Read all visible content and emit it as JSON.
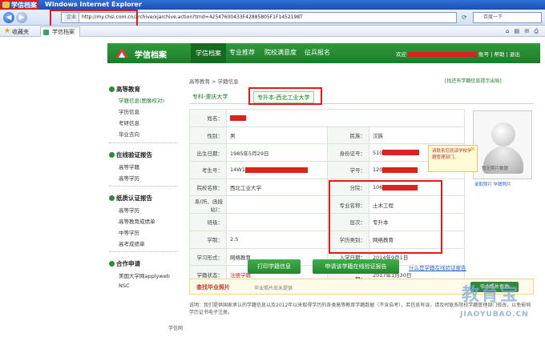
{
  "window": {
    "tab_title": "学信档案",
    "app_title": "Windows Internet Explorer"
  },
  "address": {
    "label": "企业",
    "url": "http://my.chsi.com.cn/archive/xjarchive.action?trnd=42547600433F42885805F1F1452198T"
  },
  "search": {
    "placeholder": "百度一下"
  },
  "favorites": {
    "label": "收藏夹",
    "tab": "学信档案"
  },
  "site": {
    "logo_text": "学信档案",
    "nav": [
      "学信档案",
      "专业推荐",
      "院校满意度",
      "征兵报名"
    ],
    "welcome_prefix": "欢迎",
    "account": "账号",
    "help": "帮助",
    "logout": "退出"
  },
  "sidebar": {
    "groups": [
      {
        "title": "高等教育",
        "items": [
          "学籍信息(图像校对)",
          "学历信息",
          "考研信息",
          "毕业去向"
        ]
      },
      {
        "title": "在线验证报告",
        "items": [
          "高等学籍",
          "高等学历"
        ]
      },
      {
        "title": "纸质认证报告",
        "items": [
          "高等学历",
          "高等教育成绩单",
          "中等学历",
          "高考成绩单"
        ]
      },
      {
        "title": "合作申请",
        "items": [
          "美国大学网applyweb",
          "NSC"
        ]
      }
    ]
  },
  "breadcrumb": "高等教育 > 学籍信息",
  "top_link": "[找还有学籍信息提示出局]",
  "tabs": {
    "first": "专科-重庆大学",
    "second": "专升本-西北工业大学"
  },
  "info": {
    "name_label": "姓名：",
    "gender_label": "性别：",
    "gender": "男",
    "ethnicity_label": "民族：",
    "ethnicity": "汉族",
    "birth_label": "出生日期：",
    "birth": "1985年5月29日",
    "id_label": "身份证号：",
    "id_prefix": "510",
    "exam_label": "考生号：",
    "exam_prefix": "14W1",
    "student_no_label": "学号：",
    "student_no_prefix": "120",
    "school_label": "院校名称：",
    "school": "西北工业大学",
    "branch_label": "分院：",
    "branch_prefix": "106",
    "dept_label": "系(所、函授站)：",
    "major_label": "专业名称：",
    "major": "土木工程",
    "class_label": "班级：",
    "level_label": "层次：",
    "level": "专升本",
    "duration_label": "学制：",
    "duration": "2.5",
    "type_label": "学历类别：",
    "type": "网络教育",
    "form_label": "学习形式：",
    "form": "网络教育",
    "enroll_label": "入学日期：",
    "enroll": "2014年9月1日",
    "status_label": "学籍状态：",
    "status": "注册学籍",
    "grad_label": "预计毕业日期：",
    "grad": "2017年1月30日"
  },
  "photo": {
    "tooltip": "请联系您就读学校学籍管理部门。",
    "caption": "暂无照片数据",
    "links": "录取照片   学籍照片"
  },
  "buttons": {
    "print": "打印学籍信息",
    "apply": "申请该学籍在线验证报告",
    "help_link": "什么是学籍在线验证报告"
  },
  "grad_photo": {
    "title": "查找毕业照片",
    "subtitle": "毕业照片尚未提供",
    "btn": "毕业照片查询"
  },
  "note": "说明：我们提供国家承认的学籍信息以及2012年以来取得学历的各类高等教育学籍数据（不含自考）。若信息有误，请及时联系院校学籍管理部门修改，以免影响学历证书电子注册。",
  "footer": "学信网",
  "watermark": {
    "line1": "教育宝",
    "line2": "JIAOYUBAO.CN"
  }
}
